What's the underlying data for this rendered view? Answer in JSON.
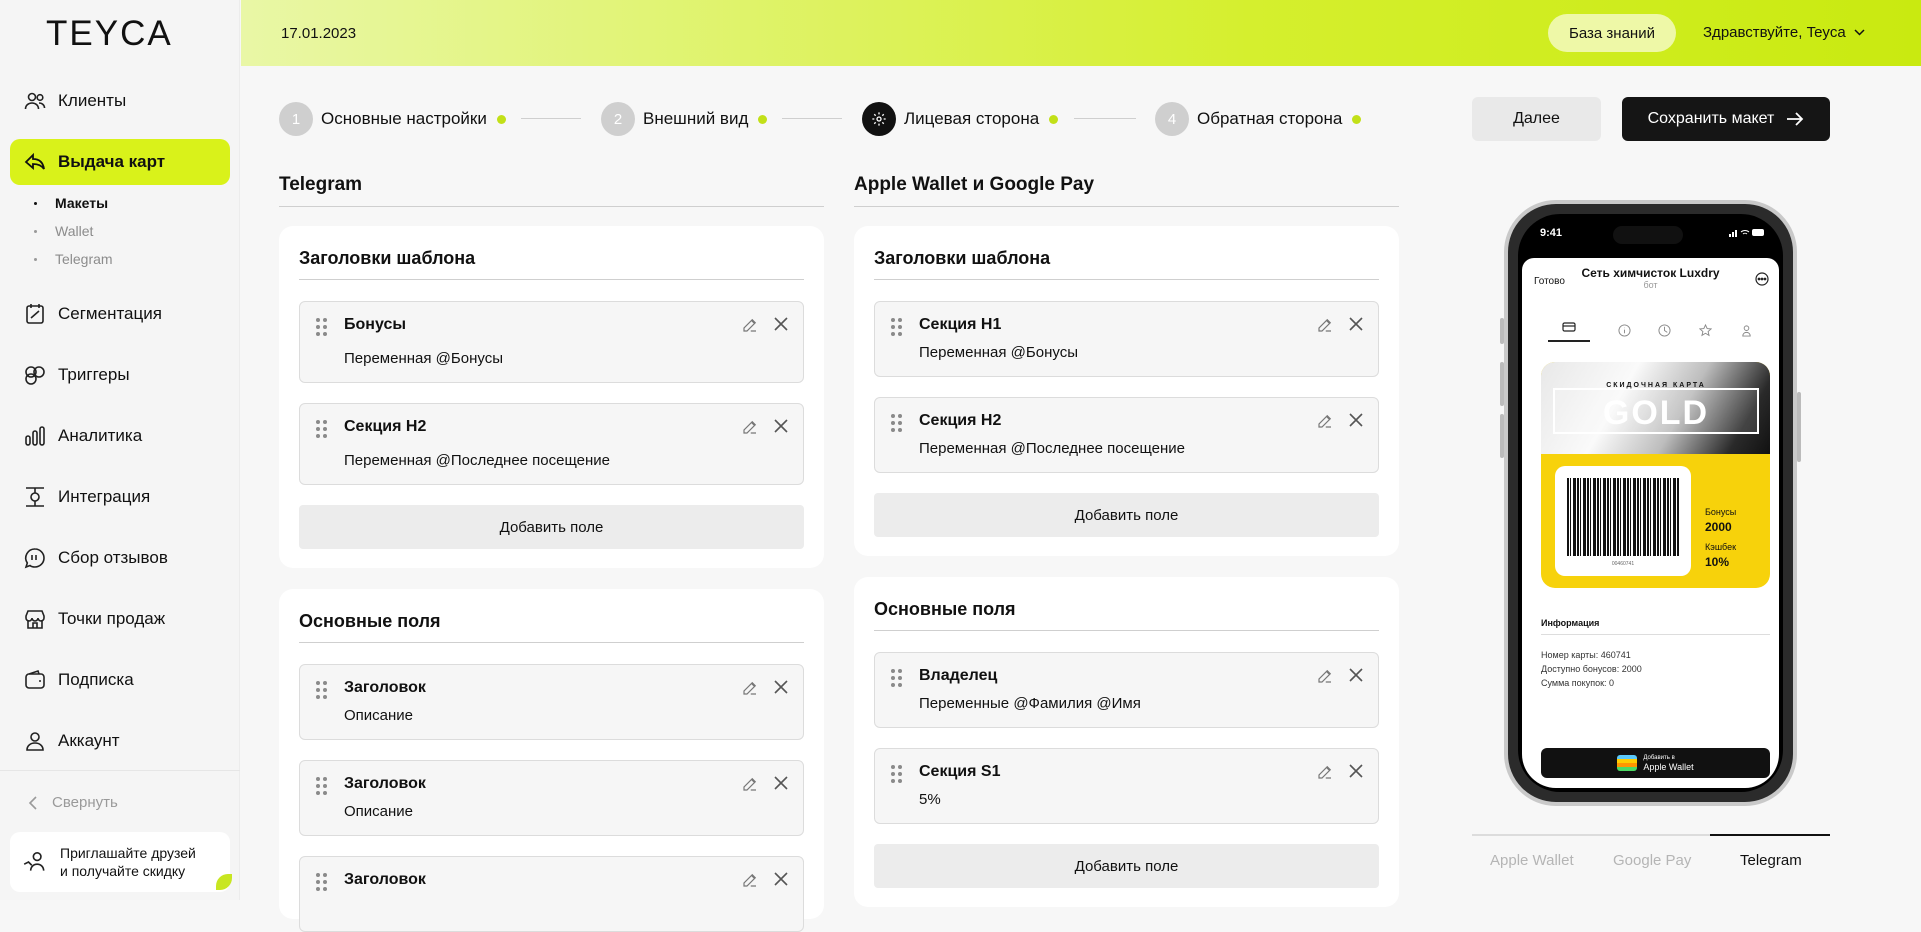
{
  "brand": {
    "logo": "TEYCA",
    "accent": "#d9f21a"
  },
  "sidebar": {
    "items": [
      {
        "label": "Клиенты",
        "icon": "users-icon"
      },
      {
        "label": "Выдача карт",
        "icon": "card-issue-icon"
      },
      {
        "label": "Сегментация",
        "icon": "segment-icon"
      },
      {
        "label": "Триггеры",
        "icon": "trigger-icon"
      },
      {
        "label": "Аналитика",
        "icon": "analytics-icon"
      },
      {
        "label": "Интеграция",
        "icon": "integration-icon"
      },
      {
        "label": "Сбор отзывов",
        "icon": "feedback-icon"
      },
      {
        "label": "Точки продаж",
        "icon": "store-icon"
      },
      {
        "label": "Подписка",
        "icon": "wallet-icon"
      },
      {
        "label": "Аккаунт",
        "icon": "user-icon"
      }
    ],
    "subitems": [
      "Макеты",
      "Wallet",
      "Telegram"
    ],
    "collapse": "Свернуть",
    "invite": [
      "Приглашайте друзей",
      "и получайте скидку"
    ]
  },
  "header": {
    "date": "17.01.2023",
    "kb": "База знаний",
    "greeting": "Здравствуйте, Teyca"
  },
  "steps": [
    {
      "num": "1",
      "label": "Основные настройки"
    },
    {
      "num": "2",
      "label": "Внешний вид"
    },
    {
      "num": "",
      "label": "Лицевая сторона"
    },
    {
      "num": "4",
      "label": "Обратная сторона"
    }
  ],
  "actions": {
    "next": "Далее",
    "save": "Сохранить макет"
  },
  "telegram": {
    "title": "Telegram",
    "headers": {
      "title": "Заголовки шаблона",
      "fields": [
        {
          "title": "Бонусы",
          "desc": "Переменная @Бонусы"
        },
        {
          "title": "Секция H2",
          "desc": "Переменная @Последнее посещение"
        }
      ],
      "add": "Добавить поле"
    },
    "main": {
      "title": "Основные поля",
      "fields": [
        {
          "title": "Заголовок",
          "desc": "Описание"
        },
        {
          "title": "Заголовок",
          "desc": "Описание"
        },
        {
          "title": "Заголовок",
          "desc": ""
        }
      ]
    }
  },
  "apple": {
    "title": "Apple Wallet и Google Pay",
    "headers": {
      "title": "Заголовки шаблона",
      "fields": [
        {
          "title": "Секция H1",
          "desc": "Переменная @Бонусы"
        },
        {
          "title": "Секция H2",
          "desc": "Переменная @Последнее посещение"
        }
      ],
      "add": "Добавить поле"
    },
    "main": {
      "title": "Основные поля",
      "fields": [
        {
          "title": "Владелец",
          "desc": "Переменные @Фамилия @Имя"
        },
        {
          "title": "Секция S1",
          "desc": "5%"
        }
      ],
      "add": "Добавить поле"
    }
  },
  "phone": {
    "time": "9:41",
    "done": "Готово",
    "bot_name": "Сеть химчисток Luxdry",
    "bot_sub": "бот",
    "card_kind": "СКИДОЧНАЯ КАРТА",
    "card_name": "GOLD",
    "barcode_num": "00460741",
    "bonus_label": "Бонусы",
    "bonus_value": "2000",
    "cash_label": "Кэшбек",
    "cash_value": "10%",
    "info_title": "Информация",
    "info_lines": [
      "Номер карты: 460741",
      "Доступно бонусов: 2000",
      "Сумма покупок: 0"
    ],
    "wallet_btn": [
      "Добавить в",
      "Apple Wallet"
    ],
    "card_color": "#f7d20b"
  },
  "preview_tabs": [
    "Apple Wallet",
    "Google Pay",
    "Telegram"
  ]
}
